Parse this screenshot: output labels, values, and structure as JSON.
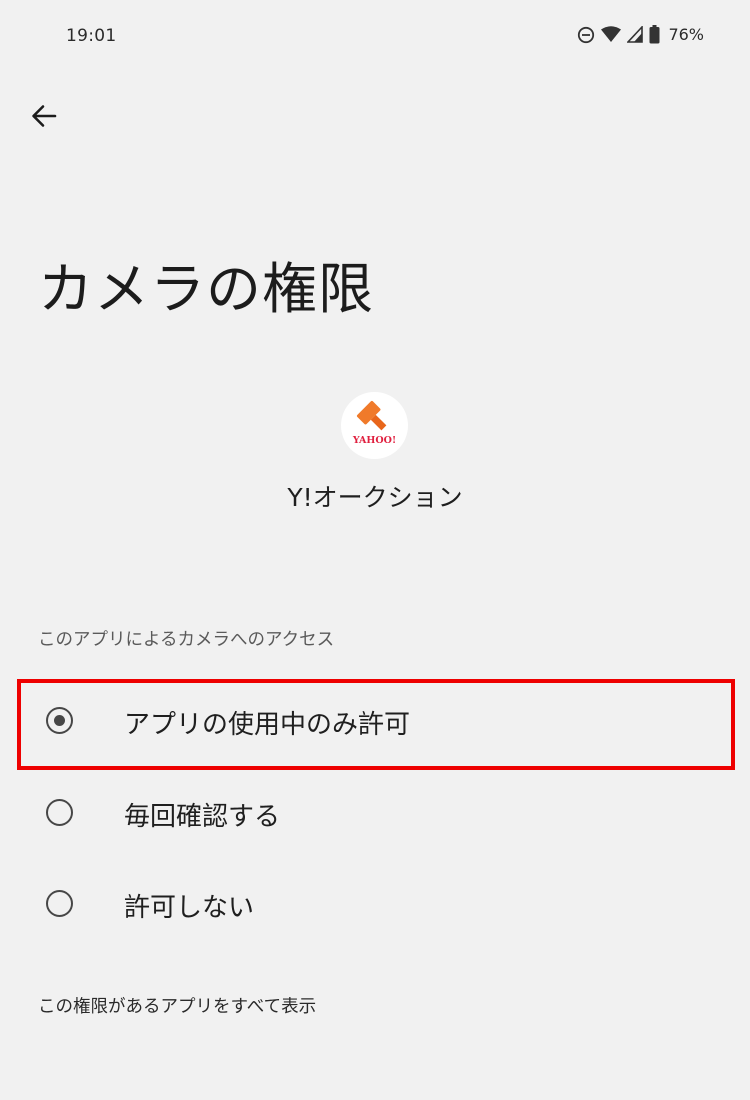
{
  "status_bar": {
    "time": "19:01",
    "battery": "76%",
    "icons": [
      "do-not-disturb-icon",
      "wifi-icon",
      "cellular-signal-icon",
      "battery-icon"
    ]
  },
  "nav": {
    "back_icon": "arrow-left-icon"
  },
  "page": {
    "title": "カメラの権限"
  },
  "app": {
    "name": "Y!オークション",
    "icon": "yahoo-auction-gavel-icon",
    "logo_text": "YAHOO!"
  },
  "section": {
    "label": "このアプリによるカメラへのアクセス"
  },
  "options": [
    {
      "label": "アプリの使用中のみ許可",
      "selected": true
    },
    {
      "label": "毎回確認する",
      "selected": false
    },
    {
      "label": "許可しない",
      "selected": false
    }
  ],
  "footer": {
    "link": "この権限があるアプリをすべて表示"
  },
  "colors": {
    "background": "#f1f1f1",
    "highlight": "#ee0000",
    "radio": "#474747",
    "gavel": "#f07a2a"
  }
}
